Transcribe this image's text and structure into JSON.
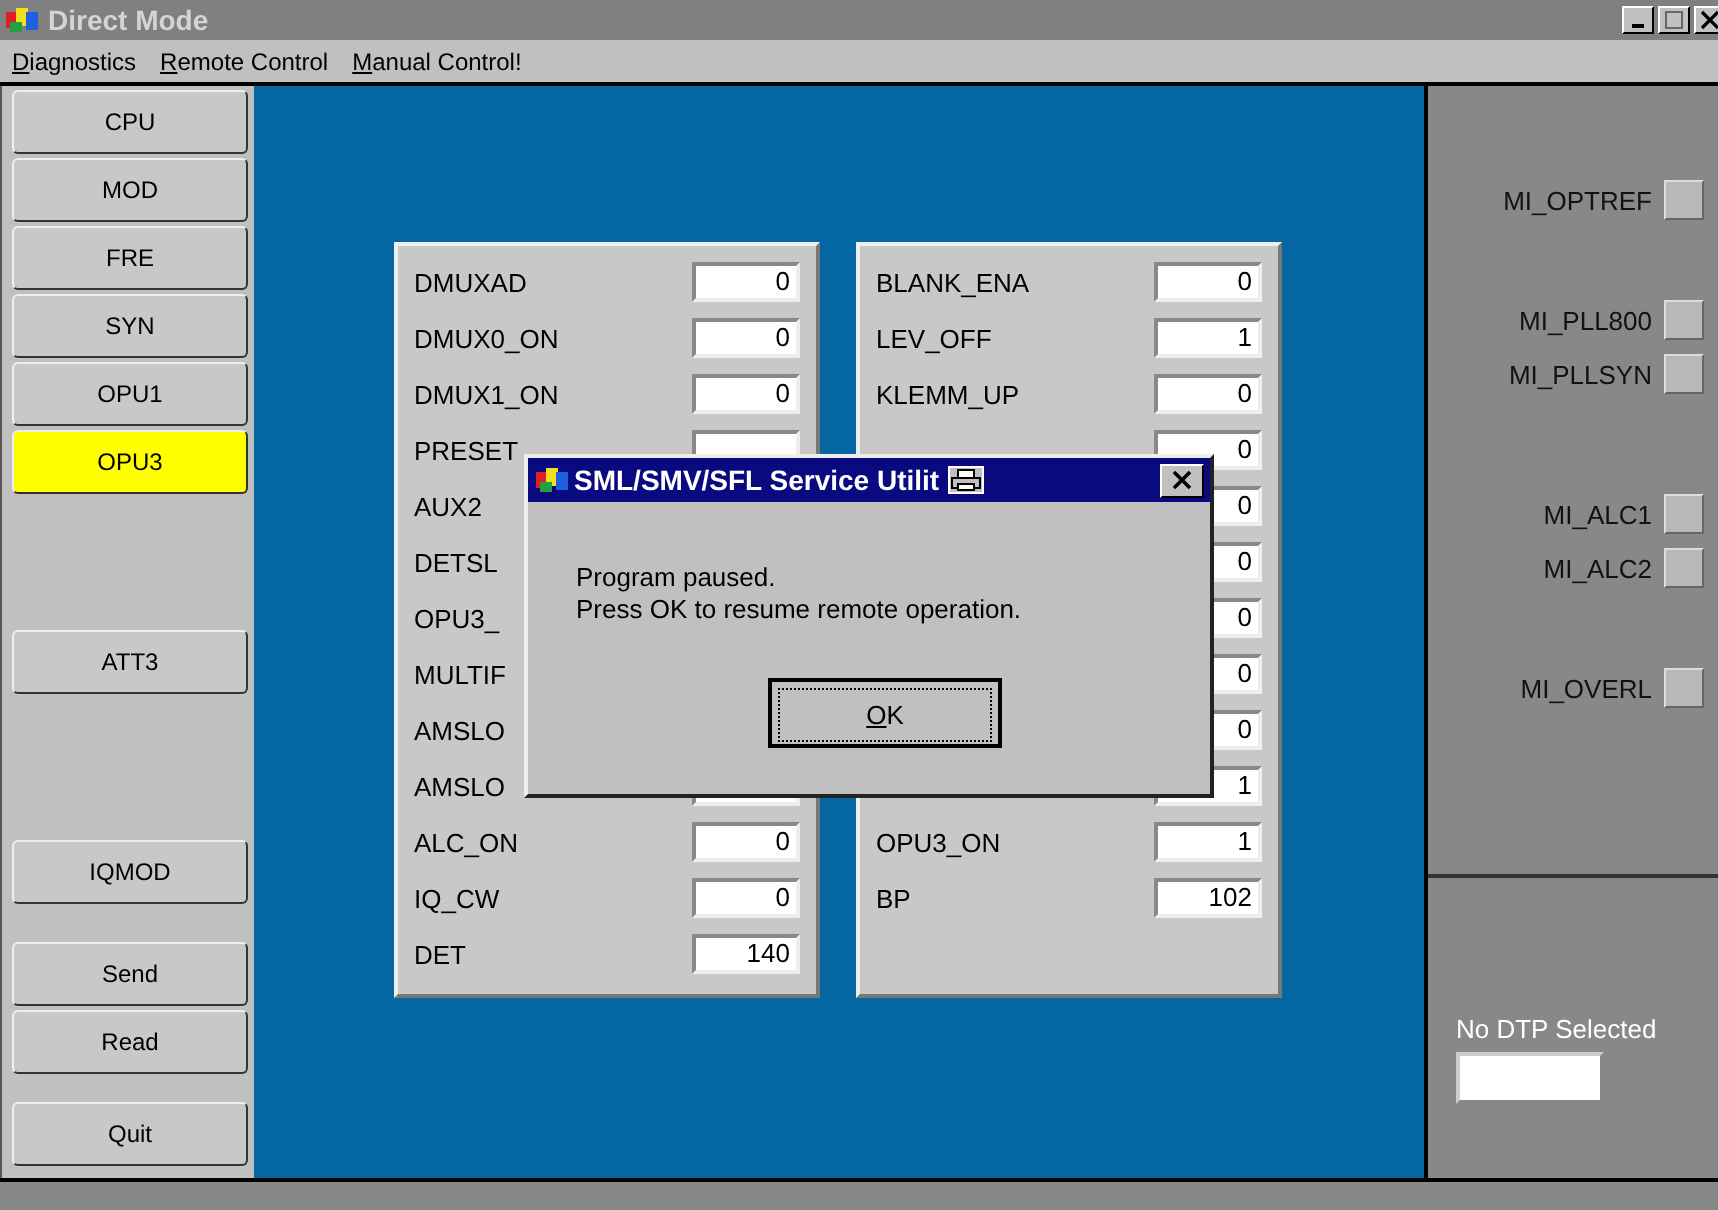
{
  "window": {
    "title": "Direct Mode"
  },
  "menu": [
    "Diagnostics",
    "Remote Control",
    "Manual Control!"
  ],
  "sidebar": {
    "groups": [
      [
        {
          "label": "CPU",
          "selected": false
        },
        {
          "label": "MOD",
          "selected": false
        },
        {
          "label": "FRE",
          "selected": false
        },
        {
          "label": "SYN",
          "selected": false
        },
        {
          "label": "OPU1",
          "selected": false
        },
        {
          "label": "OPU3",
          "selected": true
        }
      ],
      [
        {
          "label": "ATT3",
          "selected": false
        }
      ],
      [
        {
          "label": "IQMOD",
          "selected": false
        }
      ],
      [
        {
          "label": "Send",
          "selected": false
        },
        {
          "label": "Read",
          "selected": false
        }
      ],
      [
        {
          "label": "Quit",
          "selected": false
        }
      ]
    ]
  },
  "panels": [
    {
      "rows": [
        {
          "label": "DMUXAD",
          "value": "0"
        },
        {
          "label": "DMUX0_ON",
          "value": "0"
        },
        {
          "label": "DMUX1_ON",
          "value": "0"
        },
        {
          "label": "PRESET"
        },
        {
          "label": "AUX2"
        },
        {
          "label": "DETSL"
        },
        {
          "label": "OPU3_"
        },
        {
          "label": "MULTIF"
        },
        {
          "label": "AMSLO"
        },
        {
          "label": "AMSLO"
        },
        {
          "label": "ALC_ON",
          "value": "0"
        },
        {
          "label": "IQ_CW",
          "value": "0"
        },
        {
          "label": "DET",
          "value": "140"
        }
      ]
    },
    {
      "rows": [
        {
          "label": "BLANK_ENA",
          "value": "0"
        },
        {
          "label": "LEV_OFF",
          "value": "1"
        },
        {
          "label": "KLEMM_UP",
          "value": "0"
        },
        {
          "value": "0"
        },
        {
          "value": "0"
        },
        {
          "value": "0"
        },
        {
          "value": "0"
        },
        {
          "value": "0"
        },
        {
          "value": "0"
        },
        {
          "value": "1"
        },
        {
          "label": "OPU3_ON",
          "value": "1"
        },
        {
          "label": "BP",
          "value": "102"
        }
      ]
    }
  ],
  "indicators": {
    "groups": [
      [
        "MI_OPTREF"
      ],
      [
        "MI_PLL800",
        "MI_PLLSYN"
      ],
      [
        "MI_ALC1",
        "MI_ALC2"
      ],
      [
        "MI_OVERL"
      ]
    ]
  },
  "dtp": {
    "label": "No DTP Selected"
  },
  "dialog": {
    "title": "SML/SMV/SFL Service Utilit",
    "lines": [
      "Program paused.",
      "Press OK to resume remote operation."
    ],
    "button": "OK"
  }
}
